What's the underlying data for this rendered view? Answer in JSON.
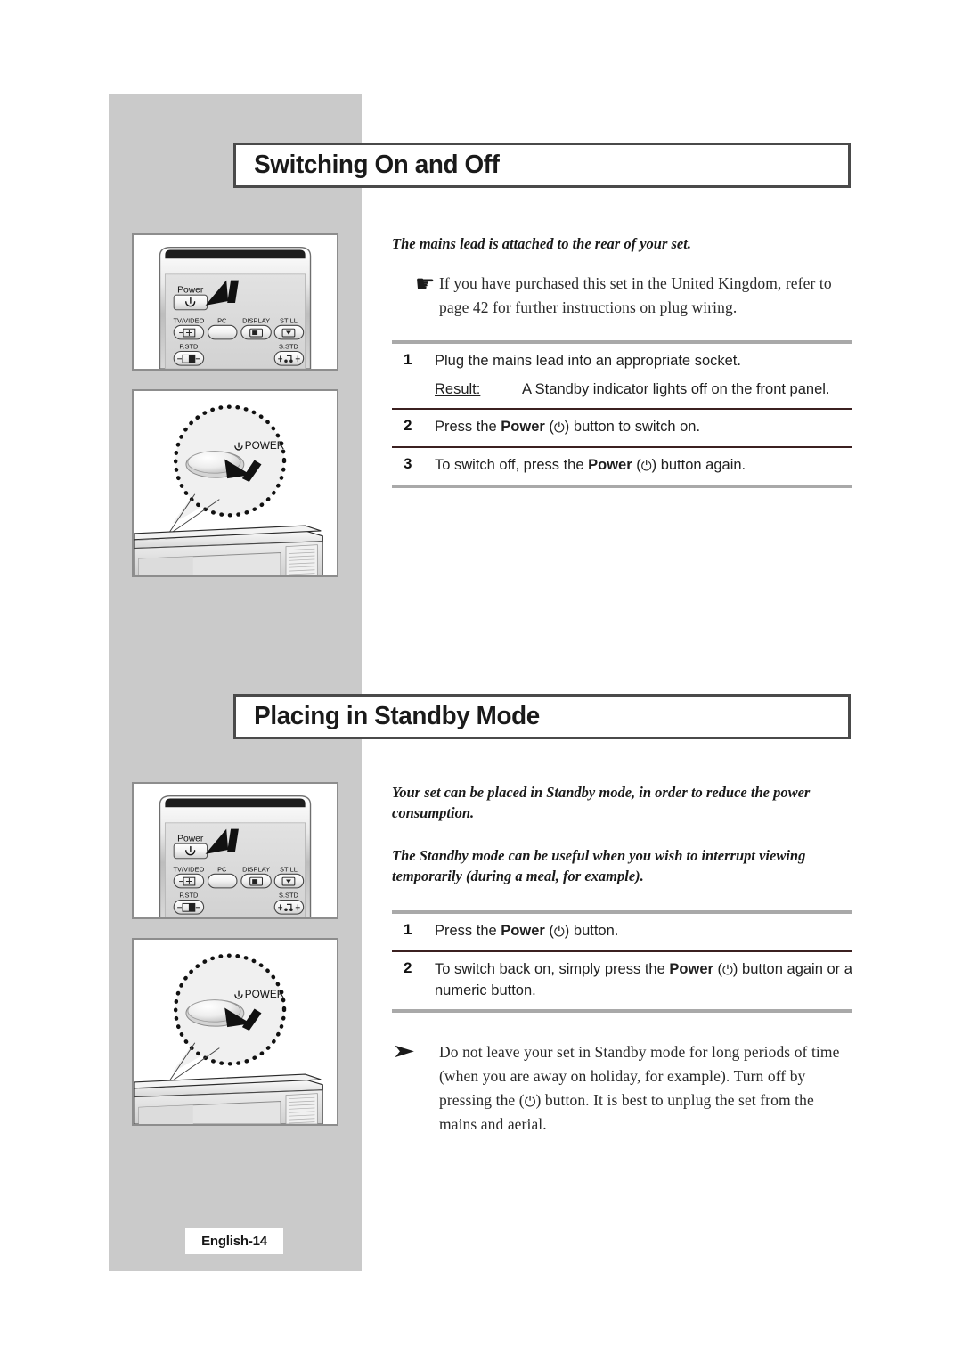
{
  "page": {
    "footer_label": "English-14"
  },
  "sections": [
    {
      "heading": "Switching On and Off",
      "lead": "The mains lead is attached to the rear of your set.",
      "note": {
        "icon": "pointing-hand-icon",
        "glyph": "☛",
        "text": "If you have purchased this set in the United Kingdom, refer to page 42 for further instructions on plug wiring."
      },
      "steps": [
        {
          "num": "1",
          "text_pre": "Plug the mains lead into an appropriate socket.",
          "result_label": "Result:",
          "result_text": "A Standby indicator lights off on the front panel."
        },
        {
          "num": "2",
          "text_pre": "Press the ",
          "bold": "Power",
          "power_open": " (",
          "power_symbol": "⏻",
          "power_close": ") ",
          "text_post": "button to switch on."
        },
        {
          "num": "3",
          "text_pre": "To switch off, press the ",
          "bold": "Power",
          "power_open": " (",
          "power_symbol": "⏻",
          "power_close": ") ",
          "text_post": "button again."
        }
      ]
    },
    {
      "heading": "Placing in Standby Mode",
      "lead1": "Your set can be placed in Standby mode, in order to reduce the power consumption.",
      "lead2": "The Standby mode can be useful when you wish to interrupt viewing temporarily (during a meal, for example).",
      "steps": [
        {
          "num": "1",
          "text_pre": "Press the ",
          "bold": "Power",
          "power_open": " (",
          "power_symbol": "⏻",
          "power_close": ") ",
          "text_post": "button."
        },
        {
          "num": "2",
          "text_pre": "To switch back on, simply press the ",
          "bold": "Power",
          "power_open": " (",
          "power_symbol": "⏻",
          "power_close": ") ",
          "text_post": "button again or a numeric button."
        }
      ],
      "note": {
        "icon": "arrow-bullet-icon",
        "glyph": "➤",
        "text_a": "Do not leave your set in Standby mode for long periods of time (when you are away on holiday, for example). Turn off by pressing the (",
        "power_symbol": "⏻",
        "text_b": ") button. It is best to unplug the set from the mains and aerial."
      }
    }
  ],
  "illustrations": {
    "remote": {
      "power_label": "Power",
      "buttons": [
        {
          "label": "TV/VIDEO"
        },
        {
          "label": "PC"
        },
        {
          "label": "DISPLAY"
        },
        {
          "label": "STILL"
        },
        {
          "label": "P.STD"
        },
        {
          "label": "S.STD"
        }
      ]
    },
    "panel": {
      "power_label": "POWER",
      "power_symbol": "⏻"
    }
  },
  "colors": {
    "band_grey": "#cacaca",
    "heading_border": "#4a4a4a",
    "rule_outer": "#a9a9a9",
    "rule_inner": "#3b2020"
  }
}
